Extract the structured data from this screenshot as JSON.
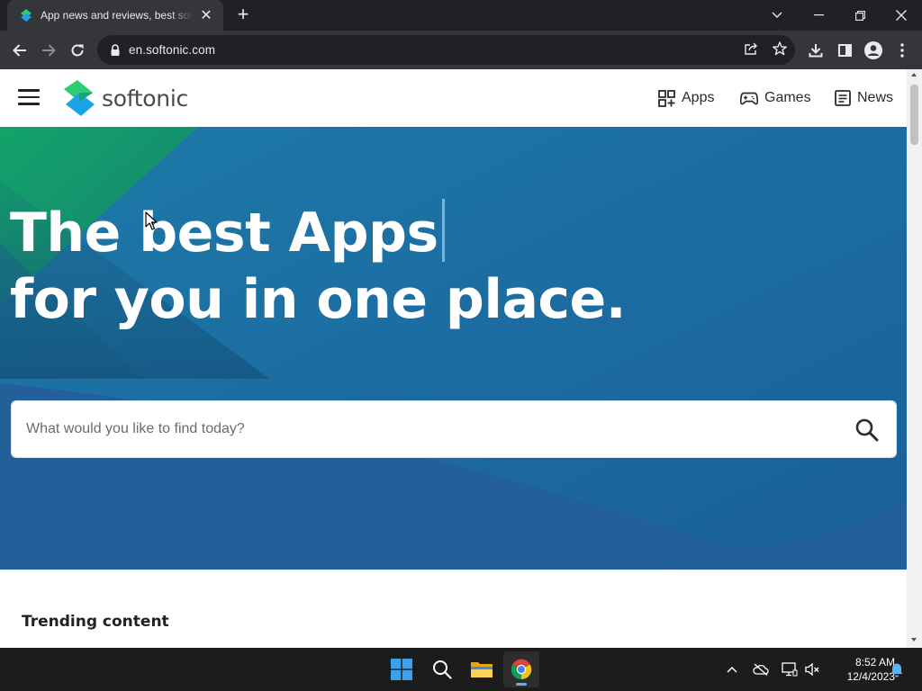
{
  "browser": {
    "tab_title": "App news and reviews, best software downloads",
    "url": "en.softonic.com",
    "tab_close": "✕",
    "new_tab": "+"
  },
  "site": {
    "brand": "softonic",
    "nav": [
      {
        "label": "Apps",
        "icon": "apps-grid-icon"
      },
      {
        "label": "Games",
        "icon": "gamepad-icon"
      },
      {
        "label": "News",
        "icon": "newspaper-icon"
      }
    ]
  },
  "hero": {
    "title_line1": "The best Apps",
    "title_line2": "for you in one place.",
    "search_placeholder": "What would you like to find today?"
  },
  "sections": {
    "trending_title": "Trending content"
  },
  "taskbar": {
    "time": "8:52 AM",
    "date": "12/4/2023"
  },
  "colors": {
    "hero_blue": "#1a6e9f",
    "hero_green": "#16a36b",
    "brand_green": "#2ecc71",
    "brand_blue": "#1ba3e8"
  }
}
